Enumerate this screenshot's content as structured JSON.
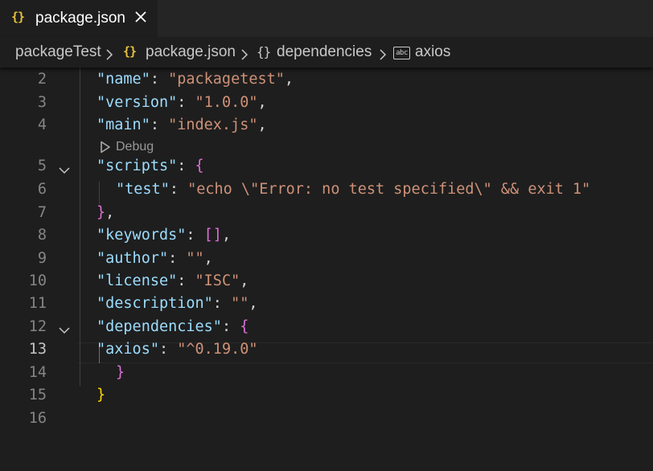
{
  "tab": {
    "icon": "{}",
    "icon_name": "json-braces-icon",
    "label": "package.json",
    "close_icon": "close-icon"
  },
  "breadcrumb": {
    "items": [
      {
        "label": "packageTest"
      },
      {
        "label": "package.json",
        "icon": "{}"
      },
      {
        "label": "dependencies",
        "icon": "{}"
      },
      {
        "label": "axios",
        "icon": "abc"
      }
    ]
  },
  "codelens": {
    "label": "Debug",
    "icon": "play-icon"
  },
  "editor": {
    "active_line": 13,
    "lines": [
      {
        "n": "2",
        "tokens": [
          [
            "key",
            "\"name\""
          ],
          [
            "pun",
            ": "
          ],
          [
            "str",
            "\"packagetest\""
          ],
          [
            "pun",
            ","
          ]
        ]
      },
      {
        "n": "3",
        "tokens": [
          [
            "key",
            "\"version\""
          ],
          [
            "pun",
            ": "
          ],
          [
            "str",
            "\"1.0.0\""
          ],
          [
            "pun",
            ","
          ]
        ]
      },
      {
        "n": "4",
        "tokens": [
          [
            "key",
            "\"main\""
          ],
          [
            "pun",
            ": "
          ],
          [
            "str",
            "\"index.js\""
          ],
          [
            "pun",
            ","
          ]
        ]
      },
      {
        "n": "5",
        "tokens": [
          [
            "key",
            "\"scripts\""
          ],
          [
            "pun",
            ": "
          ],
          [
            "brace-p",
            "{"
          ]
        ]
      },
      {
        "n": "6",
        "tokens": [
          [
            "key",
            "\"test\""
          ],
          [
            "pun",
            ": "
          ],
          [
            "str",
            "\"echo \\\"Error: no test specified\\\" && exit 1\""
          ]
        ]
      },
      {
        "n": "7",
        "tokens": [
          [
            "brace-p",
            "}"
          ],
          [
            "pun",
            ","
          ]
        ]
      },
      {
        "n": "8",
        "tokens": [
          [
            "key",
            "\"keywords\""
          ],
          [
            "pun",
            ": "
          ],
          [
            "brace-p",
            "[]"
          ],
          [
            "pun",
            ","
          ]
        ]
      },
      {
        "n": "9",
        "tokens": [
          [
            "key",
            "\"author\""
          ],
          [
            "pun",
            ": "
          ],
          [
            "str",
            "\"\""
          ],
          [
            "pun",
            ","
          ]
        ]
      },
      {
        "n": "10",
        "tokens": [
          [
            "key",
            "\"license\""
          ],
          [
            "pun",
            ": "
          ],
          [
            "str",
            "\"ISC\""
          ],
          [
            "pun",
            ","
          ]
        ]
      },
      {
        "n": "11",
        "tokens": [
          [
            "key",
            "\"description\""
          ],
          [
            "pun",
            ": "
          ],
          [
            "str",
            "\"\""
          ],
          [
            "pun",
            ","
          ]
        ]
      },
      {
        "n": "12",
        "tokens": [
          [
            "key",
            "\"dependencies\""
          ],
          [
            "pun",
            ": "
          ],
          [
            "brace-p",
            "{"
          ]
        ]
      },
      {
        "n": "13",
        "tokens": [
          [
            "key",
            "\"axios\""
          ],
          [
            "pun",
            ": "
          ],
          [
            "str",
            "\"^0.19.0\""
          ]
        ]
      },
      {
        "n": "14",
        "tokens": [
          [
            "brace-p",
            "}"
          ]
        ]
      },
      {
        "n": "15",
        "tokens": [
          [
            "brace-y",
            "}"
          ]
        ]
      },
      {
        "n": "16",
        "tokens": []
      }
    ]
  },
  "colors": {
    "background": "#1e1e1e",
    "key": "#9cdcfe",
    "string": "#ce9178",
    "brace_level1": "#ffd700",
    "brace_level2": "#da70d6"
  }
}
